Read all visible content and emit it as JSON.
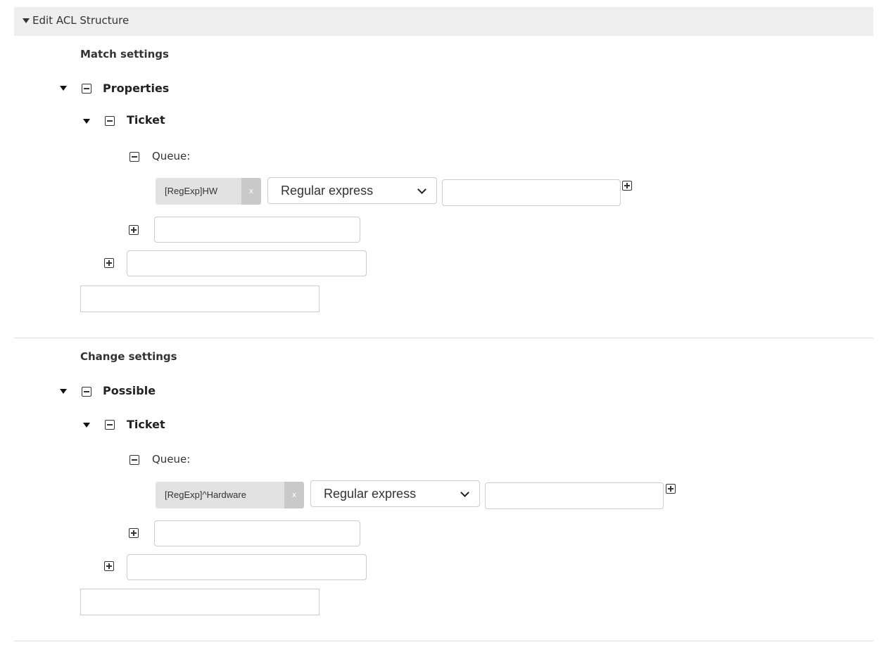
{
  "panel": {
    "title": "Edit ACL Structure"
  },
  "match": {
    "section_title": "Match settings",
    "level1_label": "Properties",
    "level2_label": "Ticket",
    "field_label": "Queue:",
    "tag_value": "[RegExp]HW",
    "tag_remove": "x",
    "operator_select": "Regular express",
    "value_input": "",
    "add_field_input": "",
    "add_object_input": "",
    "add_section_input": ""
  },
  "change": {
    "section_title": "Change settings",
    "level1_label": "Possible",
    "level2_label": "Ticket",
    "field_label": "Queue:",
    "tag_value": "[RegExp]^Hardware",
    "tag_remove": "x",
    "operator_select": "Regular express",
    "value_input": "",
    "add_field_input": "",
    "add_object_input": "",
    "add_section_input": ""
  },
  "icons": {
    "collapse": "collapse-box-icon",
    "expand": "expand-box-icon",
    "caret": "caret-down-icon"
  }
}
